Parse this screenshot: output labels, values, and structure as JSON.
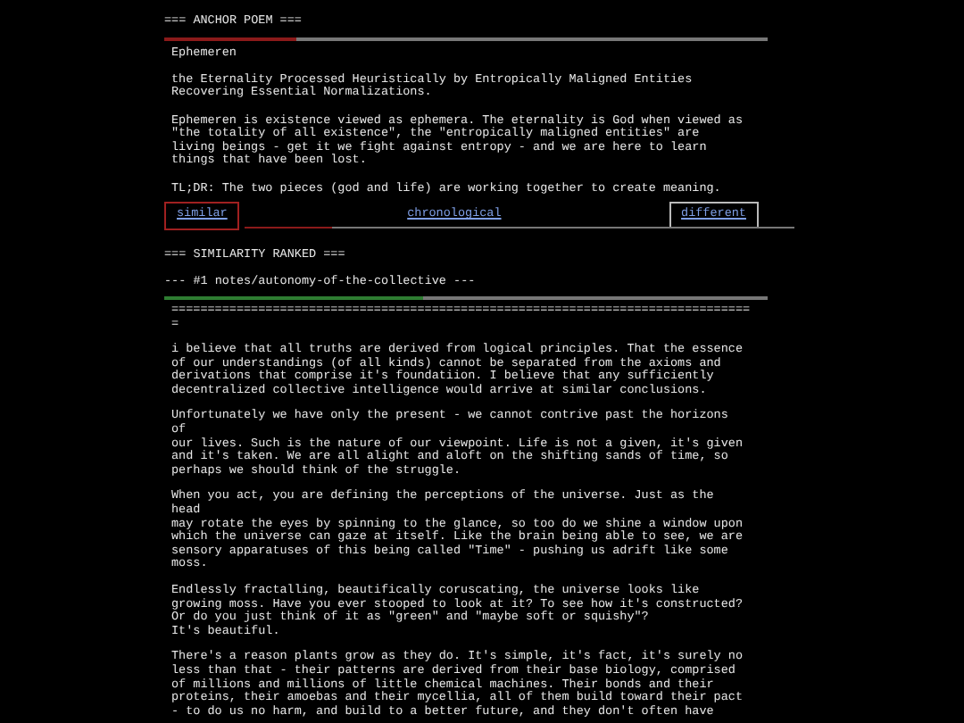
{
  "anchor": {
    "heading": "=== ANCHOR POEM ===",
    "underline": {
      "level": 0.22,
      "color": "#8b1a1a"
    },
    "paragraphs": [
      "Ephemeren",
      "the Eternality Processed Heuristically by Entropically Maligned Entities\nRecovering Essential Normalizations.",
      "Ephemeren is existence viewed as ephemera. The eternality is God when viewed as\n\"the totality of all existence\", the \"entropically maligned entities\" are\nliving beings - get it we fight against entropy - and we are here to learn\nthings that have been lost.",
      "TL;DR: The two pieces (god and life) are working together to create meaning."
    ]
  },
  "tabs": [
    {
      "label": "similar",
      "selected": true,
      "outlined": true
    },
    {
      "label": "chronological",
      "selected": false,
      "outlined": false
    },
    {
      "label": "different",
      "selected": false,
      "outlined": true
    }
  ],
  "tabs_underline": {
    "level": 0.16,
    "color": "#8b1a1a"
  },
  "ranked": {
    "heading": "=== SIMILARITY RANKED ===",
    "entry_title": "--- #1 notes/autonomy-of-the-collective ---",
    "underline": {
      "level": 0.43,
      "color": "#2e7d32"
    },
    "separator": "================================================================================\n=",
    "paragraphs": [
      "i believe that all truths are derived from logical principles. That the essence\nof our understandings (of all kinds) cannot be separated from the axioms and\nderivations that comprise it's foundatiion. I believe that any sufficiently\ndecentralized collective intelligence would arrive at similar conclusions.",
      "Unfortunately we have only the present - we cannot contrive past the horizons\nof\nour lives. Such is the nature of our viewpoint. Life is not a given, it's given\nand it's taken. We are all alight and aloft on the shifting sands of time, so\nperhaps we should think of the struggle.",
      "When you act, you are defining the perceptions of the universe. Just as the\nhead\nmay rotate the eyes by spinning to the glance, so too do we shine a window upon\nwhich the universe can gaze at itself. Like the brain being able to see, we are\nsensory apparatuses of this being called \"Time\" - pushing us adrift like some\nmoss.",
      "Endlessly fractalling, beautifically coruscating, the universe looks like\ngrowing moss. Have you ever stooped to look at it? To see how it's constructed?\nOr do you just think of it as \"green\" and \"maybe soft or squishy\"?\nIt's beautiful.",
      "There's a reason plants grow as they do. It's simple, it's fact, it's surely no\nless than that - their patterns are derived from their base biology, comprised\nof millions and millions of little chemical machines. Their bonds and their\nproteins, their amoebas and their mycellia, all of them build toward their pact\n- to do us no harm, and build to a better future, and they don't often have"
    ]
  }
}
